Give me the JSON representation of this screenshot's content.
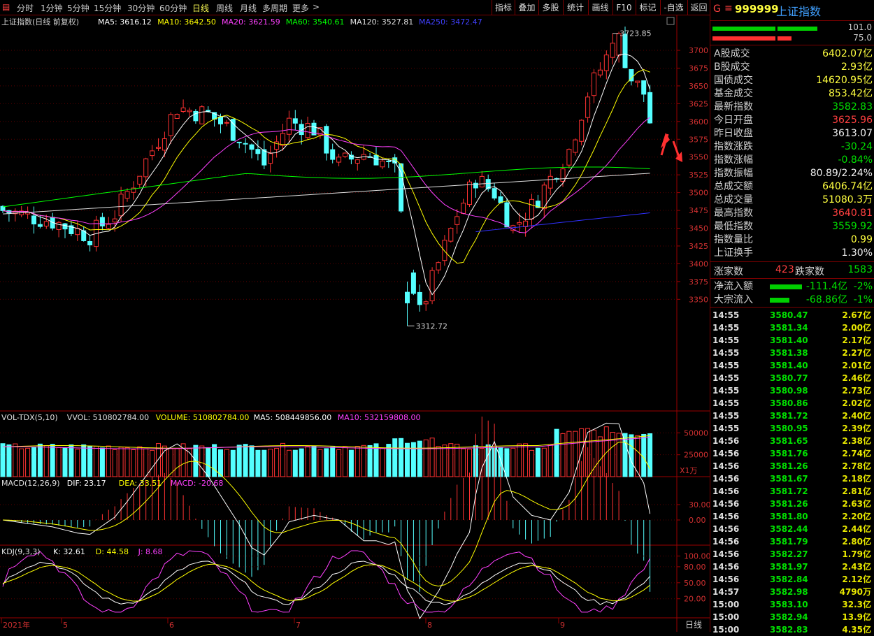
{
  "toolbar": {
    "periods": [
      "分时",
      "1分钟",
      "5分钟",
      "15分钟",
      "30分钟",
      "60分钟",
      "日线",
      "周线",
      "月线",
      "多周期",
      "更多"
    ],
    "active_period": "日线",
    "more_arrow": ">",
    "tools": [
      "指标",
      "叠加",
      "多股",
      "统计",
      "画线",
      "F10",
      "标记",
      "-自选",
      "返回"
    ]
  },
  "main_legend": {
    "title": "上证指数(日线 前复权)",
    "items": [
      {
        "label": "MA5: 3616.12",
        "color": "#ffffff"
      },
      {
        "label": "MA10: 3642.50",
        "color": "#ffff00"
      },
      {
        "label": "MA20: 3621.59",
        "color": "#ff40ff"
      },
      {
        "label": "MA60: 3540.61",
        "color": "#00ff00"
      },
      {
        "label": "MA120: 3527.81",
        "color": "#e0e0e0"
      },
      {
        "label": "MA250: 3472.47",
        "color": "#4040ff"
      }
    ],
    "high_label": "3723.85",
    "low_label": "3312.72",
    "y_ticks": [
      "3700",
      "3675",
      "3650",
      "3625",
      "3600",
      "3575",
      "3550",
      "3525",
      "3500",
      "3475",
      "3450",
      "3425",
      "3400",
      "3375",
      "3350"
    ]
  },
  "vol_legend": {
    "items": [
      {
        "label": "VOL-TDX(5,10)",
        "color": "#e0e0e0"
      },
      {
        "label": "VVOL: 510802784.00",
        "color": "#e0e0e0"
      },
      {
        "label": "VOLUME: 510802784.00",
        "color": "#ffff00"
      },
      {
        "label": "MA5: 508449856.00",
        "color": "#ffffff"
      },
      {
        "label": "MA10: 532159808.00",
        "color": "#ff40ff"
      }
    ],
    "y_ticks": [
      "50000",
      "25000"
    ],
    "unit": "X1万"
  },
  "macd_legend": {
    "items": [
      {
        "label": "MACD(12,26,9)",
        "color": "#e0e0e0"
      },
      {
        "label": "DIF: 23.17",
        "color": "#ffffff"
      },
      {
        "label": "DEA: 33.51",
        "color": "#ffff00"
      },
      {
        "label": "MACD: -20.68",
        "color": "#ff40ff"
      }
    ],
    "y_ticks": [
      "30.00",
      "0.00"
    ]
  },
  "kdj_legend": {
    "items": [
      {
        "label": "KDJ(9,3,3)",
        "color": "#e0e0e0"
      },
      {
        "label": "K: 32.61",
        "color": "#ffffff"
      },
      {
        "label": "D: 44.58",
        "color": "#ffff00"
      },
      {
        "label": "J: 8.68",
        "color": "#ff40ff"
      }
    ],
    "y_ticks": [
      "100.00",
      "80.00",
      "50.00",
      "20.00"
    ]
  },
  "x_axis": {
    "labels": [
      "2021年",
      "5",
      "6",
      "7",
      "8",
      "9"
    ],
    "period_label": "日线"
  },
  "panel": {
    "header": {
      "g": "G",
      "menu": "≡",
      "code": "999999",
      "name": "上证指数"
    },
    "bars": {
      "top_value": "101.0",
      "bottom_value": "75.0"
    },
    "rows": [
      {
        "label": "A股成交",
        "value": "6402.07亿",
        "color": "yel"
      },
      {
        "label": "B股成交",
        "value": "2.93亿",
        "color": "yel"
      },
      {
        "label": "国债成交",
        "value": "14620.95亿",
        "color": "yel"
      },
      {
        "label": "基金成交",
        "value": "853.42亿",
        "color": "yel"
      },
      {
        "label": "最新指数",
        "value": "3582.83",
        "color": "green"
      },
      {
        "label": "今日开盘",
        "value": "3625.96",
        "color": "red"
      },
      {
        "label": "昨日收盘",
        "value": "3613.07",
        "color": "wht"
      },
      {
        "label": "指数涨跌",
        "value": "-30.24",
        "color": "green"
      },
      {
        "label": "指数涨幅",
        "value": "-0.84%",
        "color": "green"
      },
      {
        "label": "指数振幅",
        "value": "80.89/2.24%",
        "color": "wht"
      },
      {
        "label": "总成交额",
        "value": "6406.74亿",
        "color": "yel"
      },
      {
        "label": "总成交量",
        "value": "51080.3万",
        "color": "yel"
      },
      {
        "label": "最高指数",
        "value": "3640.81",
        "color": "red"
      },
      {
        "label": "最低指数",
        "value": "3559.92",
        "color": "green"
      },
      {
        "label": "指数量比",
        "value": "0.99",
        "color": "yel"
      },
      {
        "label": "上证换手",
        "value": "1.30%",
        "color": "wht"
      }
    ],
    "breadth": {
      "up_label": "涨家数",
      "up_value": "423",
      "down_label": "跌家数",
      "down_value": "1583"
    },
    "flows": [
      {
        "label": "净流入额",
        "value": "-111.4亿",
        "pct": "-2%"
      },
      {
        "label": "大宗流入",
        "value": "-68.86亿",
        "pct": "-1%"
      }
    ],
    "ticks": [
      {
        "t": "14:55",
        "p": "3580.47",
        "v": "2.67亿"
      },
      {
        "t": "14:55",
        "p": "3581.34",
        "v": "2.00亿"
      },
      {
        "t": "14:55",
        "p": "3581.40",
        "v": "2.17亿"
      },
      {
        "t": "14:55",
        "p": "3581.38",
        "v": "2.27亿"
      },
      {
        "t": "14:55",
        "p": "3581.40",
        "v": "2.01亿"
      },
      {
        "t": "14:55",
        "p": "3580.77",
        "v": "2.46亿"
      },
      {
        "t": "14:55",
        "p": "3580.98",
        "v": "2.73亿"
      },
      {
        "t": "14:55",
        "p": "3580.86",
        "v": "2.02亿"
      },
      {
        "t": "14:55",
        "p": "3581.72",
        "v": "2.40亿"
      },
      {
        "t": "14:55",
        "p": "3580.95",
        "v": "2.39亿"
      },
      {
        "t": "14:56",
        "p": "3581.65",
        "v": "2.38亿"
      },
      {
        "t": "14:56",
        "p": "3581.76",
        "v": "2.74亿"
      },
      {
        "t": "14:56",
        "p": "3581.26",
        "v": "2.78亿"
      },
      {
        "t": "14:56",
        "p": "3581.67",
        "v": "2.18亿"
      },
      {
        "t": "14:56",
        "p": "3581.72",
        "v": "2.81亿"
      },
      {
        "t": "14:56",
        "p": "3581.26",
        "v": "2.63亿"
      },
      {
        "t": "14:56",
        "p": "3581.80",
        "v": "2.20亿"
      },
      {
        "t": "14:56",
        "p": "3582.44",
        "v": "2.44亿"
      },
      {
        "t": "14:56",
        "p": "3581.79",
        "v": "2.80亿"
      },
      {
        "t": "14:56",
        "p": "3582.27",
        "v": "1.79亿"
      },
      {
        "t": "14:56",
        "p": "3581.97",
        "v": "2.43亿"
      },
      {
        "t": "14:56",
        "p": "3582.84",
        "v": "2.12亿"
      },
      {
        "t": "14:57",
        "p": "3582.98",
        "v": "4790万"
      },
      {
        "t": "15:00",
        "p": "3583.10",
        "v": "32.3亿"
      },
      {
        "t": "15:00",
        "p": "3582.94",
        "v": "13.9亿"
      },
      {
        "t": "15:00",
        "p": "3582.83",
        "v": "4.35亿"
      }
    ]
  }
}
